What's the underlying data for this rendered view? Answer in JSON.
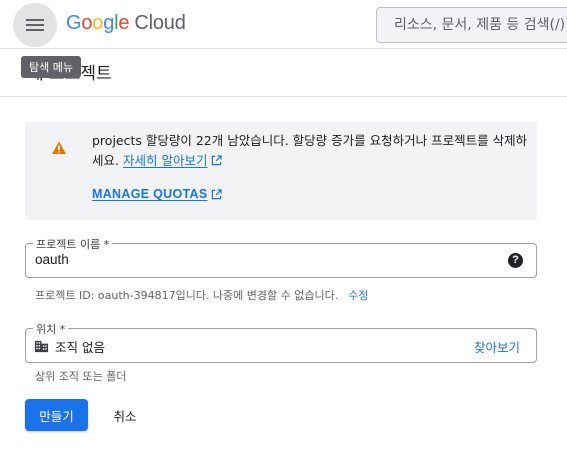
{
  "header": {
    "menu_tooltip": "탐색 메뉴",
    "logo_letters": [
      "G",
      "o",
      "o",
      "g",
      "l",
      "e"
    ],
    "logo_product": "Cloud",
    "search_placeholder": "리소스, 문서, 제품 등 검색(/)"
  },
  "page": {
    "title": "새 프로젝트"
  },
  "alert": {
    "icon": "warning-icon",
    "message": "projects 할당량이 22개 남았습니다. 할당량 증가를 요청하거나 프로젝트를 삭제하세요.",
    "learn_more": "자세히 알아보기",
    "manage_quotas": "MANAGE QUOTAS"
  },
  "project_name": {
    "label": "프로젝트 이름 *",
    "value": "oauth",
    "help_icon": "help-icon",
    "id_hint": "프로젝트 ID: oauth-394817입니다. 나중에 변경할 수 없습니다.",
    "edit_label": "수정"
  },
  "location": {
    "label": "위치 *",
    "value": "조직 없음",
    "icon": "building-icon",
    "browse_label": "찾아보기",
    "hint": "상위 조직 또는 폴더"
  },
  "actions": {
    "create_label": "만들기",
    "cancel_label": "취소"
  },
  "colors": {
    "primary": "#1a73e8",
    "warning": "#e37400",
    "alert_bg": "#f1f3f4"
  }
}
